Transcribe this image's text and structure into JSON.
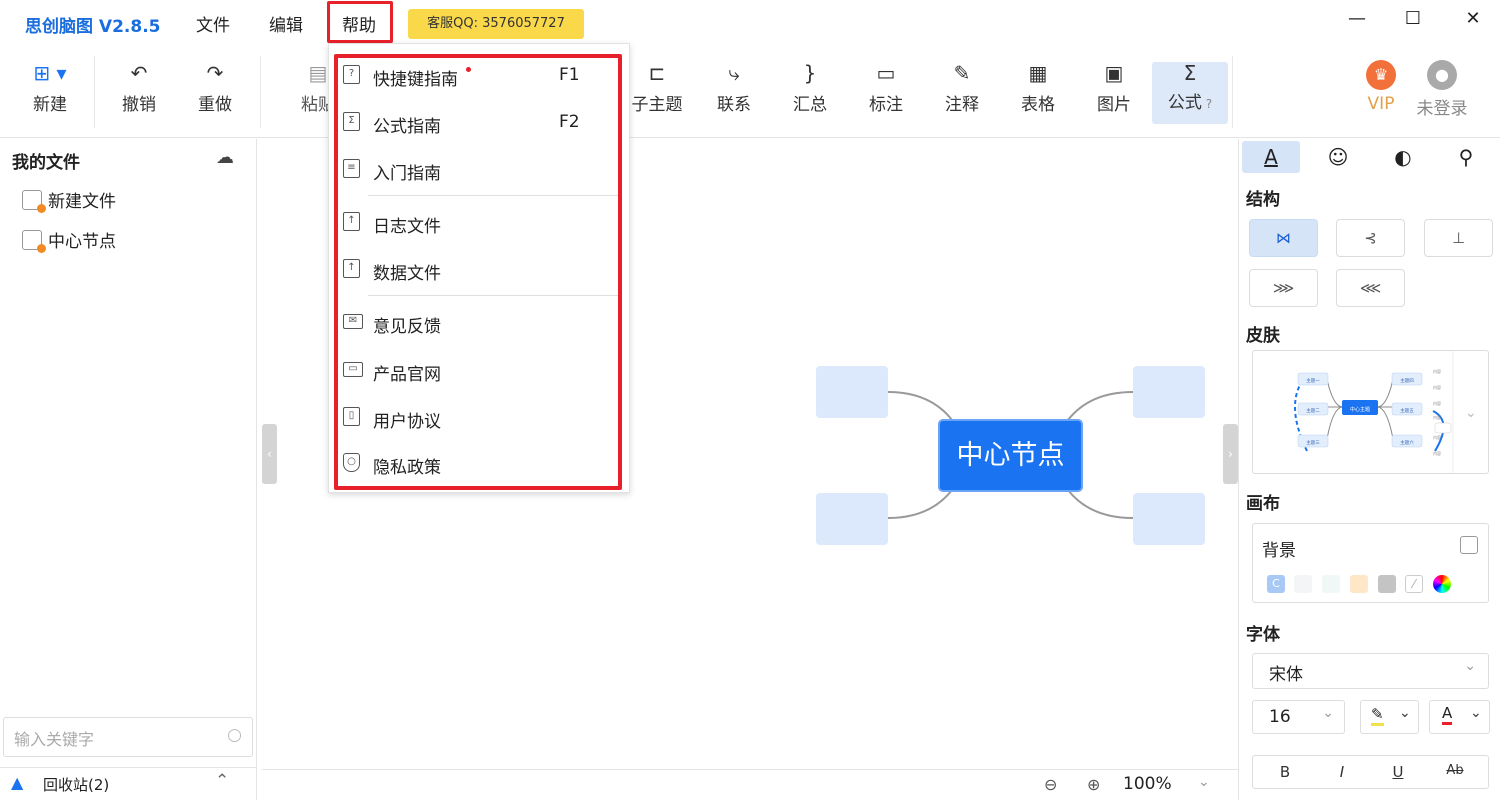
{
  "app": {
    "title": "思创脑图 V2.8.5"
  },
  "menubar": {
    "file": "文件",
    "edit": "编辑",
    "help": "帮助"
  },
  "support_badge": "客服QQ: 3576057727",
  "window_controls": {
    "minimize": "—",
    "maximize": "☐",
    "close": "✕"
  },
  "toolbar": {
    "new": "新建",
    "undo": "撤销",
    "redo": "重做",
    "paste": "粘贴",
    "subtopic": "子主题",
    "relation": "联系",
    "summary": "汇总",
    "label": "标注",
    "note": "注释",
    "table": "表格",
    "image": "图片",
    "formula": "公式",
    "vip": "VIP",
    "login": "未登录"
  },
  "sidebar": {
    "title": "我的文件",
    "files": [
      "新建文件",
      "中心节点"
    ],
    "search_placeholder": "输入关键字",
    "recycle": "回收站(2)"
  },
  "help_menu": {
    "items": [
      {
        "label": "快捷键指南",
        "shortcut": "F1",
        "icon": "question-doc-icon"
      },
      {
        "label": "公式指南",
        "shortcut": "F2",
        "icon": "formula-doc-icon"
      },
      {
        "label": "入门指南",
        "shortcut": "",
        "icon": "list-doc-icon"
      },
      {
        "label": "日志文件",
        "shortcut": "",
        "icon": "upload-doc-icon"
      },
      {
        "label": "数据文件",
        "shortcut": "",
        "icon": "upload-doc-icon"
      },
      {
        "label": "意见反馈",
        "shortcut": "",
        "icon": "mail-icon"
      },
      {
        "label": "产品官网",
        "shortcut": "",
        "icon": "monitor-icon"
      },
      {
        "label": "用户协议",
        "shortcut": "",
        "icon": "agreement-icon"
      },
      {
        "label": "隐私政策",
        "shortcut": "",
        "icon": "shield-icon"
      }
    ]
  },
  "canvas": {
    "center_node": "中心节点"
  },
  "statusbar": {
    "zoom": "100%"
  },
  "right_panel": {
    "structure": "结构",
    "skin": "皮肤",
    "canvas": "画布",
    "background": "背景",
    "font": "字体",
    "font_family": "宋体",
    "font_size": "16",
    "skin_preview": {
      "center": "中心主题",
      "topics": [
        "主题一",
        "主题二",
        "主题三",
        "主题四",
        "主题五",
        "主题六"
      ],
      "content": "内容"
    },
    "format": {
      "bold": "B",
      "italic": "I",
      "underline": "U",
      "strike": "Ab"
    }
  },
  "colors": {
    "accent": "#1a73f0",
    "highlight_border": "#e8202a",
    "badge": "#f9d84a",
    "node_fill": "#dce8fb"
  }
}
